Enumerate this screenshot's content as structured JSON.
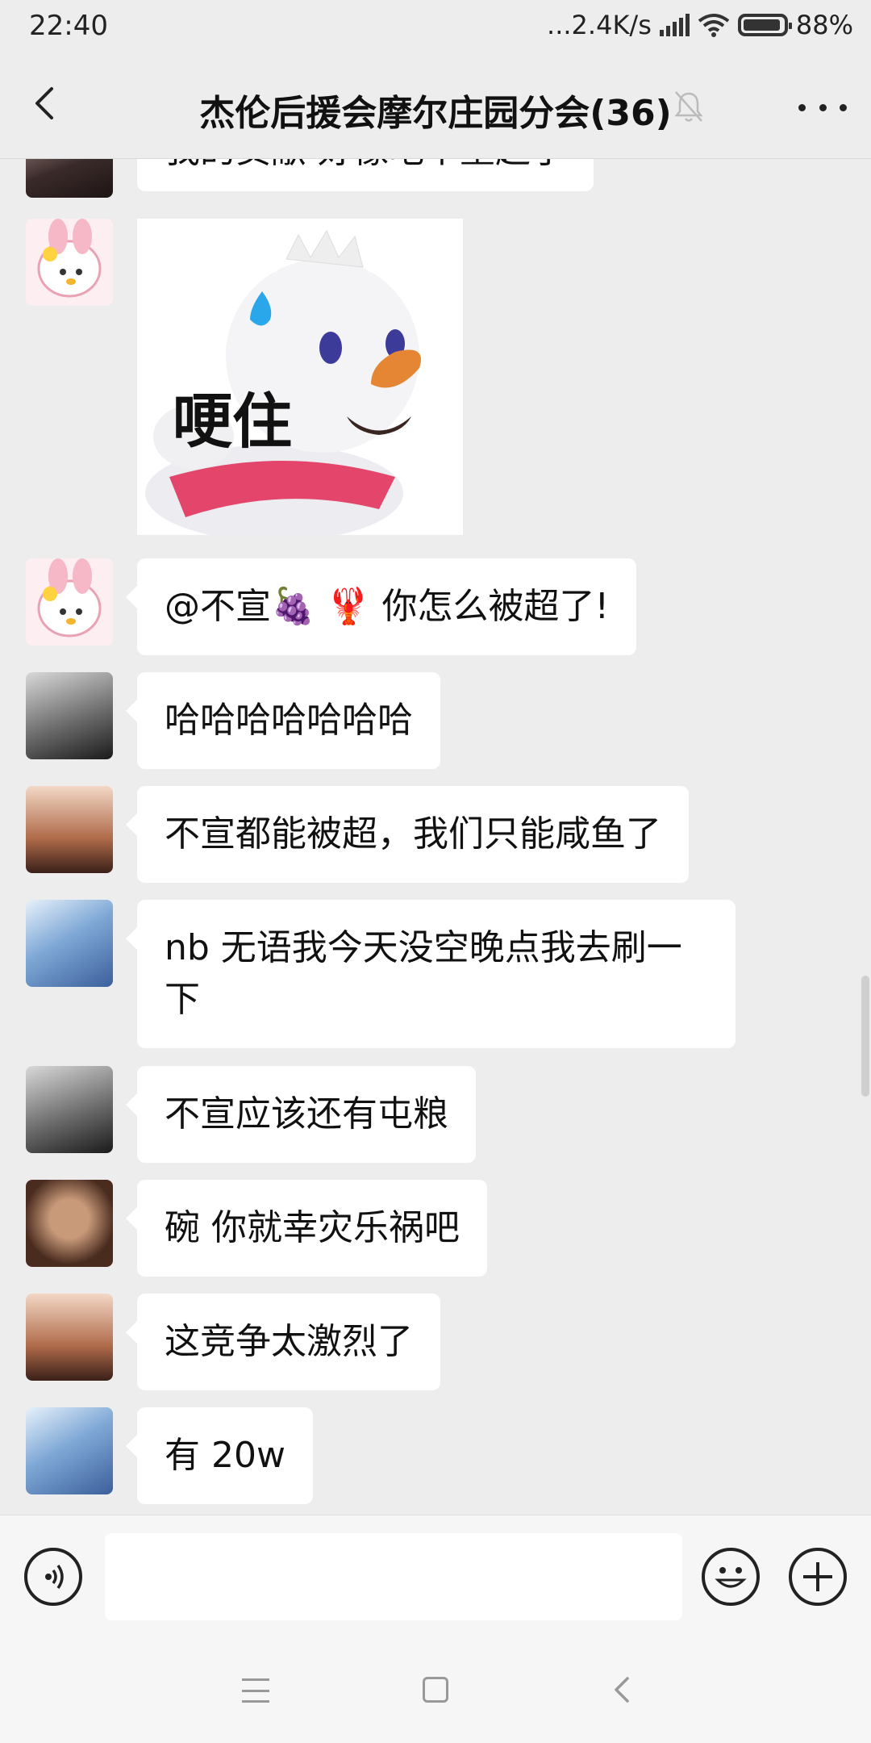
{
  "status_bar": {
    "time": "22:40",
    "net_speed": "...2.4K/s",
    "battery": "88%"
  },
  "header": {
    "title": "杰伦后援会摩尔庄园分会(36)"
  },
  "messages": [
    {
      "type": "text",
      "text": "我的贡献 好像吧个重超了"
    },
    {
      "type": "sticker",
      "text": "哽住"
    },
    {
      "type": "text",
      "text": "@不宣🍇 🦞 你怎么被超了!"
    },
    {
      "type": "text",
      "text": "哈哈哈哈哈哈哈"
    },
    {
      "type": "text",
      "text": "不宣都能被超，我们只能咸鱼了"
    },
    {
      "type": "text",
      "text": "nb 无语我今天没空晚点我去刷一\n下"
    },
    {
      "type": "text",
      "text": "不宣应该还有屯粮"
    },
    {
      "type": "text",
      "text": "碗 你就幸灾乐祸吧"
    },
    {
      "type": "text",
      "text": "这竞争太激烈了"
    },
    {
      "type": "text",
      "text": "有 20w"
    }
  ],
  "input": {
    "value": "",
    "placeholder": ""
  },
  "colors": {
    "background": "#ededed",
    "bubble": "#ffffff",
    "avatar_pink": "#f7d3dd",
    "avatar_dark": "#2b2b2b",
    "avatar_blue": "#cfe3f5"
  }
}
